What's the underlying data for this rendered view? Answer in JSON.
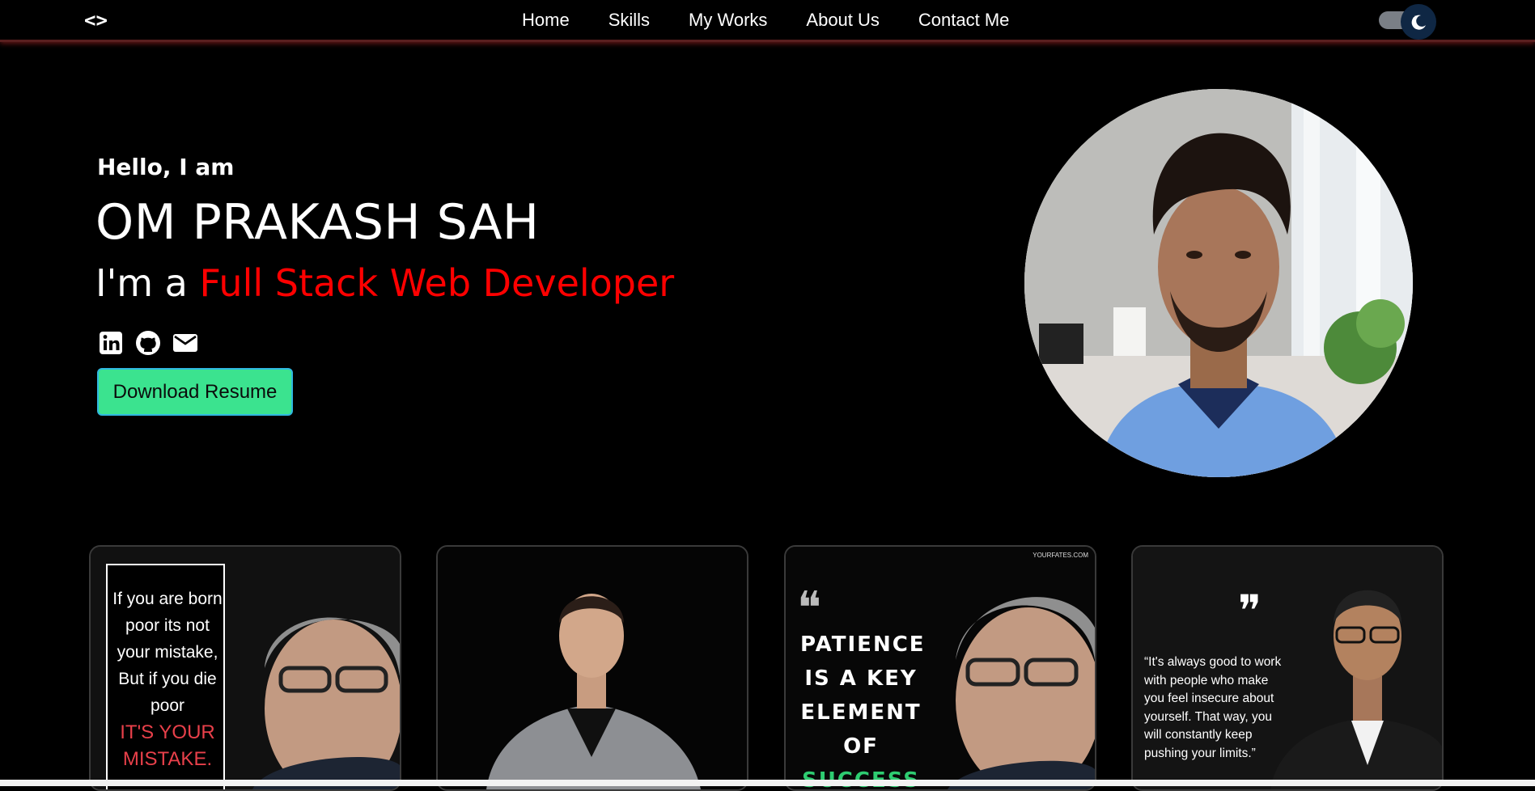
{
  "nav": {
    "logo": "<>",
    "links": [
      "Home",
      "Skills",
      "My Works",
      "About Us",
      "Contact Me"
    ],
    "theme_icon": "moon-icon"
  },
  "hero": {
    "greeting": "Hello, I am",
    "name": "OM PRAKASH SAH",
    "role_prefix": "I'm a",
    "role_highlight": "Full Stack Web Developer",
    "socials": [
      "linkedin-icon",
      "github-icon",
      "mail-icon"
    ],
    "resume_button": "Download Resume",
    "accent_color": "#ff0000",
    "button_color": "#3be38f"
  },
  "quotes": [
    {
      "lines": [
        "If you are born",
        "poor its not",
        "your mistake,",
        "But if you die",
        "poor"
      ],
      "highlight": [
        "IT'S YOUR",
        "MISTAKE."
      ]
    },
    {
      "lines": []
    },
    {
      "watermark": "YOURFATES.COM",
      "lines": [
        "PATIENCE",
        "IS A KEY",
        "ELEMENT",
        "OF"
      ],
      "highlight": [
        "SUCCESS"
      ]
    },
    {
      "lines": [
        "“It's always good to work",
        "with people who make",
        "you feel insecure about",
        "yourself. That way, you",
        "will constantly keep",
        "pushing your limits.”"
      ]
    }
  ]
}
